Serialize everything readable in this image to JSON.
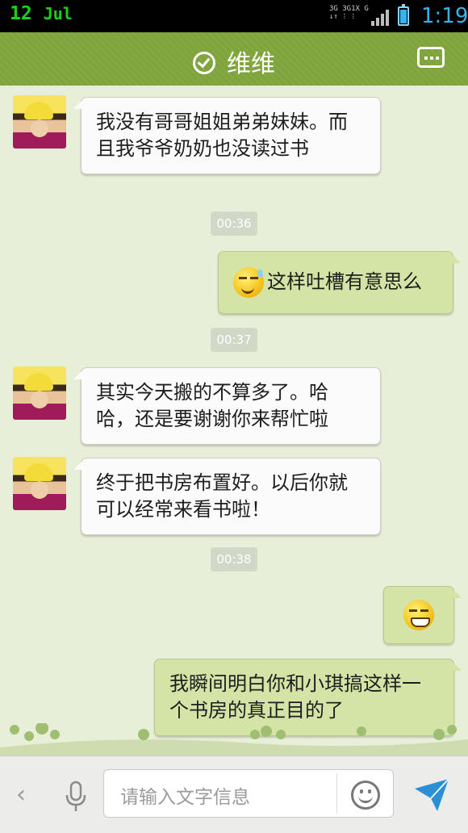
{
  "status_bar": {
    "date": "12",
    "month": "Jul",
    "network": [
      "3G 3G1X G",
      "↓↑ ⁞ ⁞"
    ],
    "time": "1:19",
    "battery_level": 0.85,
    "time_color": "#34b4ea",
    "date_color": "#19d11b"
  },
  "header": {
    "title": "维维",
    "verified_icon": "check-circle-icon",
    "menu_icon": "chat-menu-icon",
    "bg_color": "#7fa43c"
  },
  "messages": [
    {
      "side": "left",
      "text": "我没有哥哥姐姐弟弟妹妹。而且我爷爷奶奶也没读过书"
    },
    {
      "timestamp": "00:36"
    },
    {
      "side": "right",
      "emoji": "sweat-emoji",
      "text": "这样吐槽有意思么"
    },
    {
      "timestamp": "00:37"
    },
    {
      "side": "left",
      "text": "其实今天搬的不算多了。哈哈，还是要谢谢你来帮忙啦"
    },
    {
      "side": "left",
      "text": "终于把书房布置好。以后你就可以经常来看书啦！"
    },
    {
      "timestamp": "00:38"
    },
    {
      "side": "right",
      "emoji": "grin-emoji",
      "text": ""
    },
    {
      "side": "right",
      "text": "我瞬间明白你和小琪搞这样一个书房的真正目的了"
    }
  ],
  "input_bar": {
    "placeholder": "请输入文字信息",
    "back_icon": "chevron-left-icon",
    "voice_icon": "microphone-icon",
    "emoji_icon": "smiley-icon",
    "send_icon": "send-arrow-icon"
  }
}
